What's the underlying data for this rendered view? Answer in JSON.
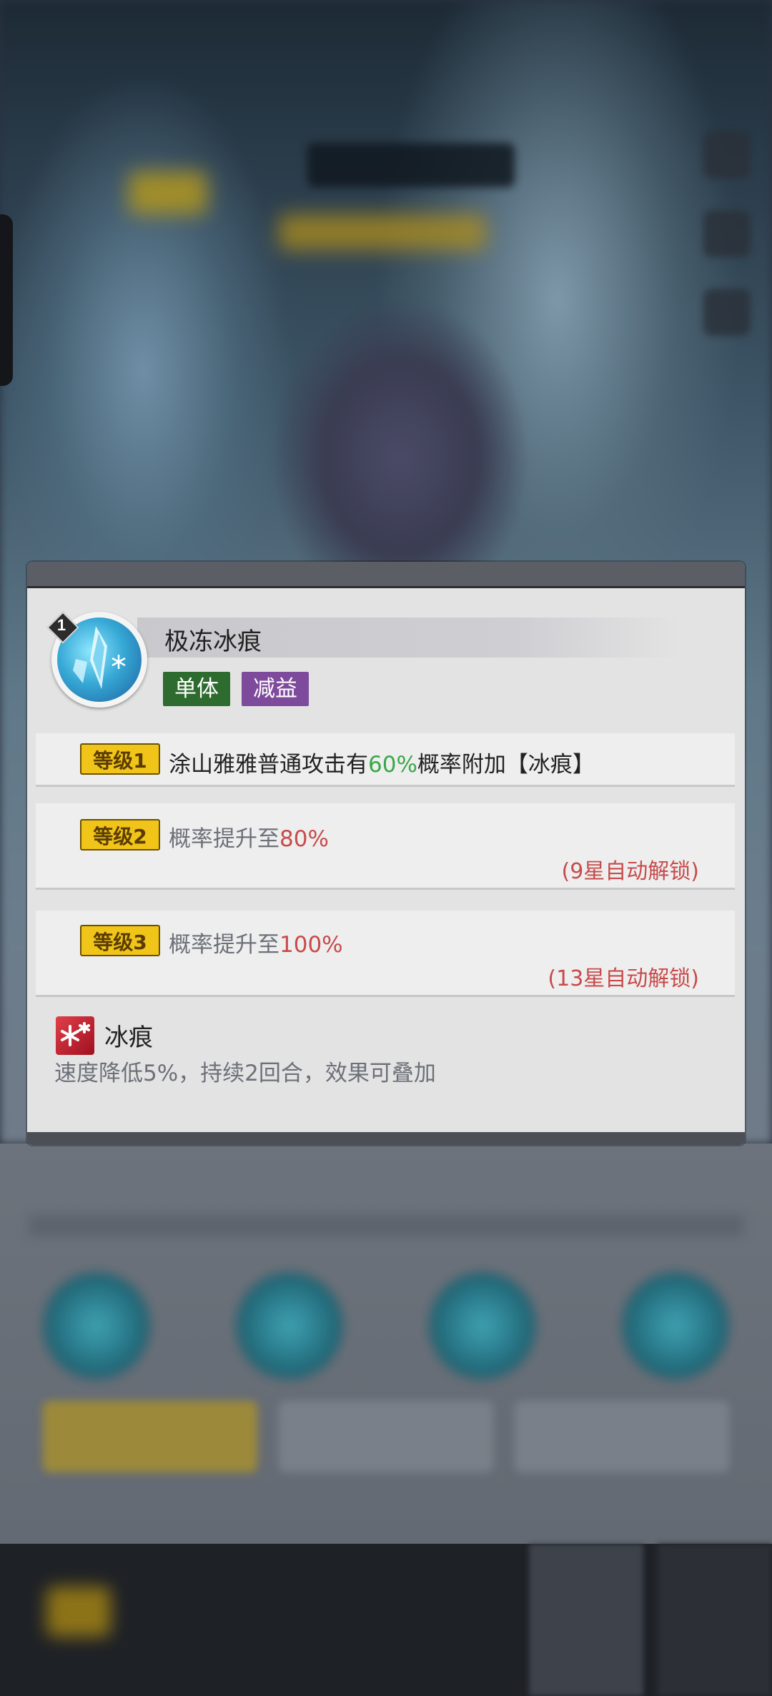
{
  "skill": {
    "level_badge": "1",
    "name": "极冻冰痕",
    "tags": [
      "单体",
      "减益"
    ]
  },
  "levels": [
    {
      "badge": "等级1",
      "text_prefix": "涂山雅雅普通攻击有",
      "text_highlight": "60%",
      "text_suffix": "概率附加【冰痕】",
      "unlock": ""
    },
    {
      "badge": "等级2",
      "text_prefix": "概率提升至",
      "text_highlight": "80%",
      "text_suffix": "",
      "unlock": "(9星自动解锁)"
    },
    {
      "badge": "等级3",
      "text_prefix": "概率提升至",
      "text_highlight": "100%",
      "text_suffix": "",
      "unlock": "(13星自动解锁)"
    }
  ],
  "debuff": {
    "name": "冰痕",
    "description": "速度降低5%，持续2回合，效果可叠加"
  },
  "colors": {
    "unlocked_highlight": "#3aa84a",
    "locked_highlight": "#c84b4b",
    "tag_single": "#2e6b2e",
    "tag_debuff": "#7e4a9c",
    "level_badge": "#f0c419"
  }
}
